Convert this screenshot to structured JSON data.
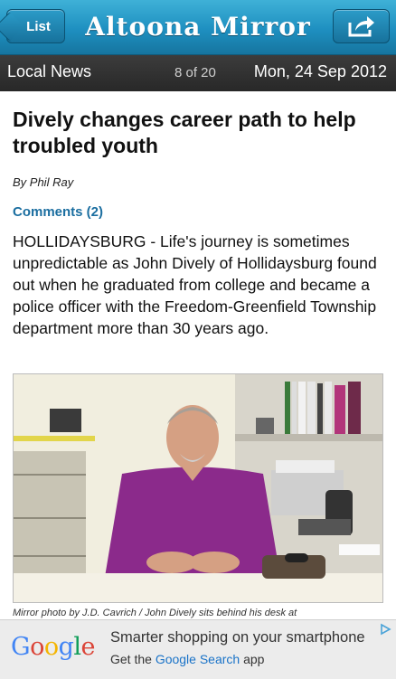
{
  "navbar": {
    "back_label": "List",
    "masthead": "Altoona Mirror",
    "share_icon": "share-icon"
  },
  "subbar": {
    "section": "Local News",
    "counter": "8 of 20",
    "date": "Mon, 24 Sep 2012"
  },
  "article": {
    "headline": "Dively changes career path to help troubled youth",
    "byline": "By Phil Ray",
    "comments": "Comments (2)",
    "body": "HOLLIDAYSBURG - Life's journey is sometimes unpredictable as John Dively of Hollidaysburg found out when he graduated from college and became a police officer with the Freedom-Greenfield Township department more than 30 years ago.",
    "caption": "Mirror photo by J.D. Cavrich / John Dively sits behind his desk at"
  },
  "ad": {
    "logo": "Google",
    "headline": "Smarter shopping on your smartphone",
    "sub_prefix": "Get the ",
    "sub_link": "Google Search",
    "sub_suffix": " app",
    "colors": {
      "blue": "#4285f4",
      "red": "#db4437",
      "yellow": "#f4b400",
      "green": "#0f9d58"
    }
  },
  "colors": {
    "navbar": "#1e8fc0",
    "subbar": "#2e2e2e",
    "comments_link": "#1b6ea0"
  }
}
